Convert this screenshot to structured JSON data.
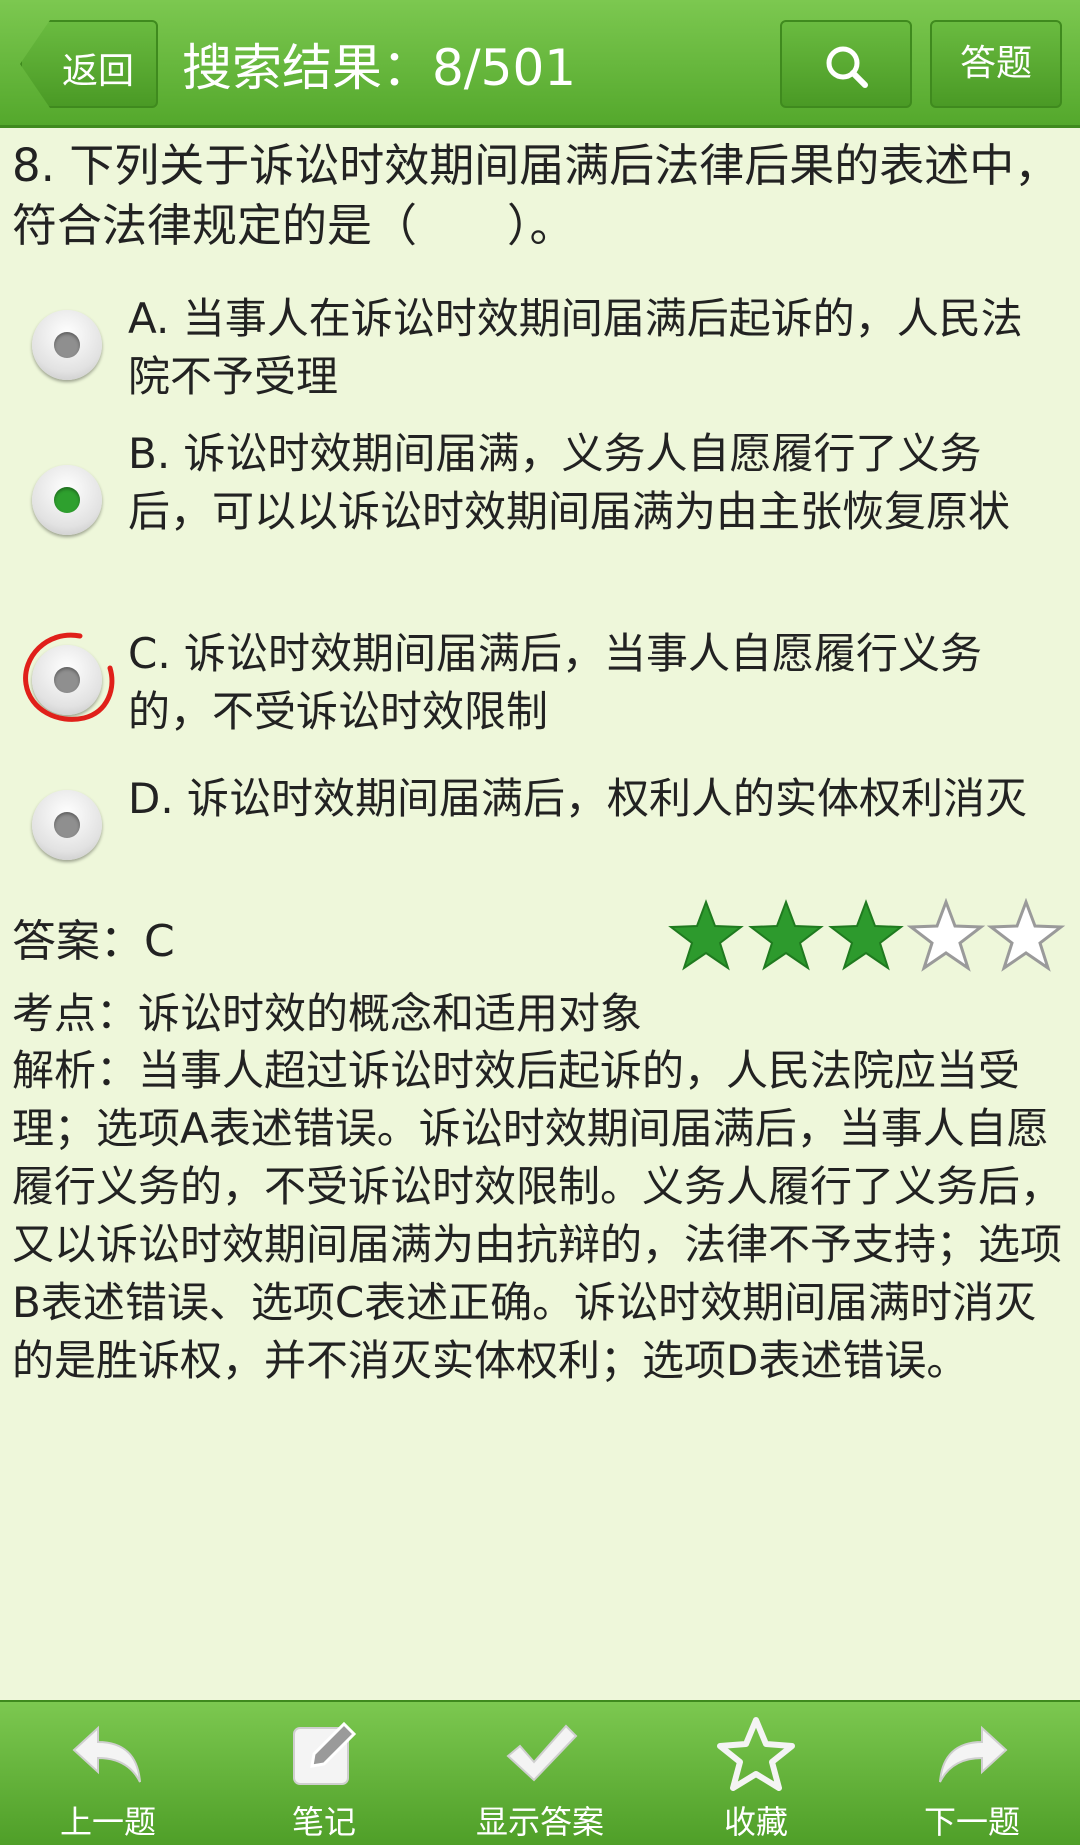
{
  "header": {
    "back_label": "返回",
    "title": "搜索结果：8/501",
    "answer_label": "答题"
  },
  "question": {
    "text": "8. 下列关于诉讼时效期间届满后法律后果的表述中，符合法律规定的是（　　）。",
    "options": [
      {
        "label": "A. 当事人在诉讼时效期间届满后起诉的，人民法院不予受理",
        "selected": false
      },
      {
        "label": "B. 诉讼时效期间届满，义务人自愿履行了义务后，可以以诉讼时效期间届满为由主张恢复原状",
        "selected": true
      },
      {
        "label": "C. 诉讼时效期间届满后，当事人自愿履行义务的，不受诉讼时效限制",
        "selected": false
      },
      {
        "label": "D. 诉讼时效期间届满后，权利人的实体权利消灭",
        "selected": false
      }
    ]
  },
  "answer": {
    "text": "答案：C",
    "difficulty_stars": 3,
    "max_stars": 5
  },
  "point": "考点：诉讼时效的概念和适用对象",
  "analysis": "解析：当事人超过诉讼时效后起诉的，人民法院应当受理；选项A表述错误。诉讼时效期间届满后，当事人自愿履行义务的，不受诉讼时效限制。义务人履行了义务后，又以诉讼时效期间届满为由抗辩的，法律不予支持；选项B表述错误、选项C表述正确。诉讼时效期间届满时消灭的是胜诉权，并不消灭实体权利；选项D表述错误。",
  "bottom_nav": {
    "prev": "上一题",
    "note": "笔记",
    "show_answer": "显示答案",
    "favorite": "收藏",
    "next": "下一题"
  },
  "colors": {
    "bar_green": "#5fb535",
    "background": "#eef7da",
    "star_filled": "#2d9a2d",
    "selected_dot": "#2ea02e",
    "red_mark": "#e0201a"
  },
  "icons": {
    "search": "search-icon",
    "prev": "undo-arrow-icon",
    "note": "edit-note-icon",
    "show_answer": "checkmark-icon",
    "favorite": "star-outline-icon",
    "next": "redo-arrow-icon"
  }
}
